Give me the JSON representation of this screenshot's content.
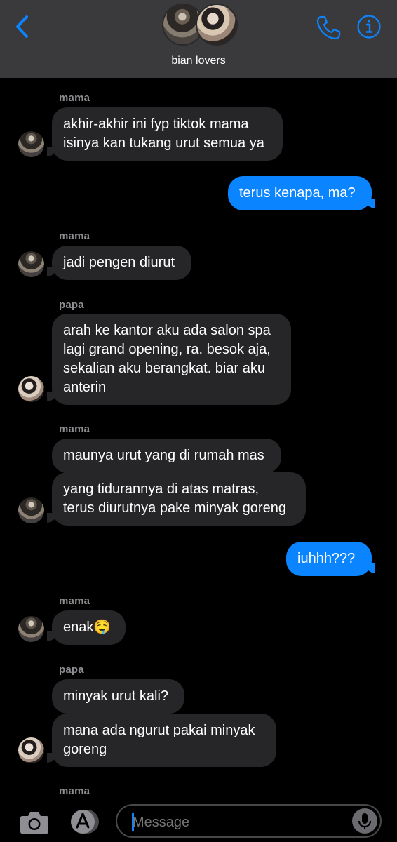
{
  "header": {
    "group_name": "bian lovers",
    "accent_color": "#0a84ff",
    "icons": [
      "chevron-left-icon",
      "phone-icon",
      "info-icon"
    ]
  },
  "messages": [
    {
      "sender": "mama",
      "text": "akhir-akhir ini fyp tiktok mama\nisinya kan tukang urut semua ya",
      "direction": "in"
    },
    {
      "text": "terus kenapa, ma?",
      "direction": "out"
    },
    {
      "sender": "mama",
      "text": "jadi pengen diurut",
      "direction": "in"
    },
    {
      "sender": "papa",
      "text": "arah ke kantor aku ada salon spa\nlagi grand opening, ra. besok aja,\nsekalian aku berangkat. biar aku\nanterin",
      "direction": "in"
    },
    {
      "sender": "mama",
      "text": "maunya urut yang di rumah mas",
      "direction": "in"
    },
    {
      "text": "yang tidurannya di atas matras,\nterus diurutnya pake minyak goreng",
      "direction": "in"
    },
    {
      "text": "iuhhh???",
      "direction": "out"
    },
    {
      "sender": "mama",
      "text": "enak🤤",
      "direction": "in"
    },
    {
      "sender": "papa",
      "text": "minyak urut kali?",
      "direction": "in"
    },
    {
      "text": "mana ada ngurut pakai minyak\ngoreng",
      "direction": "in"
    },
    {
      "sender": "mama",
      "direction": "in"
    }
  ],
  "input_bar": {
    "placeholder": "Message",
    "icons": [
      "camera-icon",
      "app-store-icon",
      "microphone-icon"
    ]
  }
}
